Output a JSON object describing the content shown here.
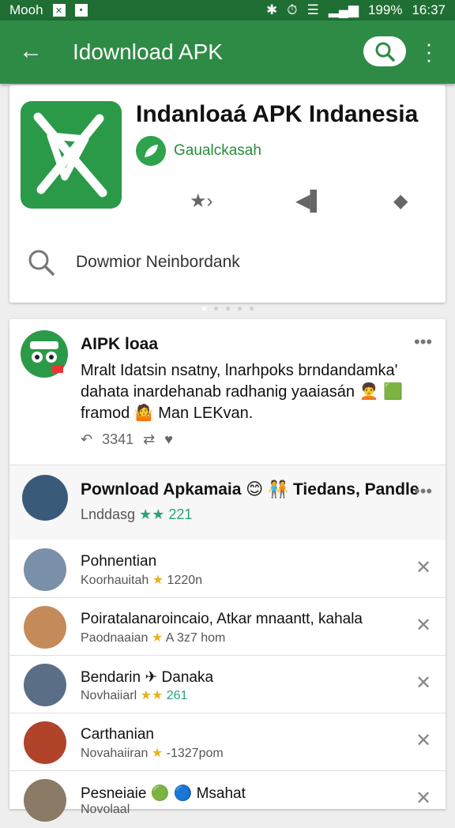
{
  "status_bar": {
    "carrier": "Mooh",
    "battery": "199%",
    "time": "16:37"
  },
  "app_bar": {
    "title": "Idownload APK"
  },
  "app_card": {
    "title": "Indanloaá APK Indanesia",
    "developer": "Gaualckasah",
    "search_text": "Dowmior Neinbordank"
  },
  "post": {
    "author": "AIPK loaa",
    "body": "Mralt Idatsin nsatny, lnarhpoks brndandamka' dahata inardehanab radhanig yaaiasán 🧑‍🦱 🟩 framod 🤷 Man LEKvan.",
    "count": "3341"
  },
  "featured": {
    "title": "Pownload Apkamaia 😊 🧑‍🤝‍🧑 Tiedans, Pandle",
    "sub_label": "Lnddasg",
    "rating": "221"
  },
  "list": [
    {
      "name": "Pohnentian",
      "sub": "Koorhauitah",
      "value": "1220n"
    },
    {
      "name": "Poiratalanaroincaio, Atkar mnaantt, kahala",
      "sub": "Paodnaaian",
      "value": "A 3z7 hom"
    },
    {
      "name": "Bendarin ✈ Danaka",
      "sub": "Novhaiiarl",
      "value": "261"
    },
    {
      "name": "Carthanian",
      "sub": "Novahaiiran",
      "value": "-1327pom"
    },
    {
      "name": "Pesneiaie 🟢 🔵 Msahat",
      "sub": "Novolaal",
      "value": ""
    }
  ],
  "colors": {
    "accent": "#2e8b45",
    "status_bar": "#1f6e33",
    "star": "#e7b21b",
    "teal": "#2aa37a"
  }
}
